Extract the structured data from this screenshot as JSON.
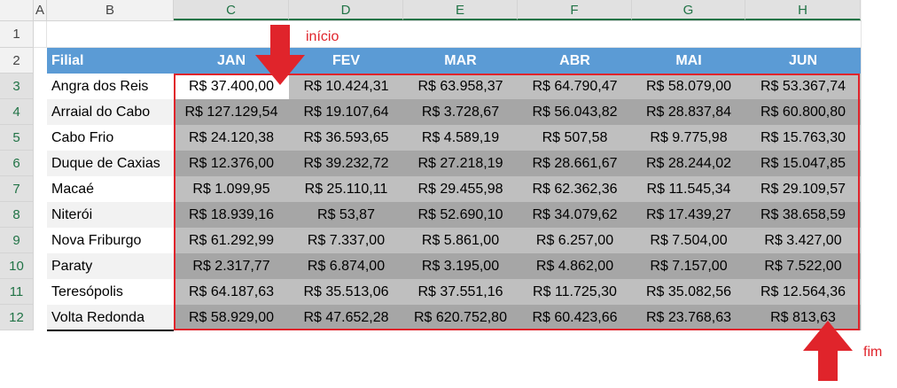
{
  "columns": [
    "A",
    "B",
    "C",
    "D",
    "E",
    "F",
    "G",
    "H"
  ],
  "rows": [
    "1",
    "2",
    "3",
    "4",
    "5",
    "6",
    "7",
    "8",
    "9",
    "10",
    "11",
    "12"
  ],
  "table": {
    "header": [
      "Filial",
      "JAN",
      "FEV",
      "MAR",
      "ABR",
      "MAI",
      "JUN"
    ],
    "rows": [
      {
        "name": "Angra dos Reis",
        "values": [
          "R$ 37.400,00",
          "R$ 10.424,31",
          "R$ 63.958,37",
          "R$ 64.790,47",
          "R$ 58.079,00",
          "R$ 53.367,74"
        ]
      },
      {
        "name": "Arraial do Cabo",
        "values": [
          "R$ 127.129,54",
          "R$ 19.107,64",
          "R$ 3.728,67",
          "R$ 56.043,82",
          "R$ 28.837,84",
          "R$ 60.800,80"
        ]
      },
      {
        "name": "Cabo Frio",
        "values": [
          "R$ 24.120,38",
          "R$ 36.593,65",
          "R$ 4.589,19",
          "R$ 507,58",
          "R$ 9.775,98",
          "R$ 15.763,30"
        ]
      },
      {
        "name": "Duque de Caxias",
        "values": [
          "R$ 12.376,00",
          "R$ 39.232,72",
          "R$ 27.218,19",
          "R$ 28.661,67",
          "R$ 28.244,02",
          "R$ 15.047,85"
        ]
      },
      {
        "name": "Macaé",
        "values": [
          "R$ 1.099,95",
          "R$ 25.110,11",
          "R$ 29.455,98",
          "R$ 62.362,36",
          "R$ 11.545,34",
          "R$ 29.109,57"
        ]
      },
      {
        "name": "Niterói",
        "values": [
          "R$ 18.939,16",
          "R$ 53,87",
          "R$ 52.690,10",
          "R$ 34.079,62",
          "R$ 17.439,27",
          "R$ 38.658,59"
        ]
      },
      {
        "name": "Nova Friburgo",
        "values": [
          "R$ 61.292,99",
          "R$ 7.337,00",
          "R$ 5.861,00",
          "R$ 6.257,00",
          "R$ 7.504,00",
          "R$ 3.427,00"
        ]
      },
      {
        "name": "Paraty",
        "values": [
          "R$ 2.317,77",
          "R$ 6.874,00",
          "R$ 3.195,00",
          "R$ 4.862,00",
          "R$ 7.157,00",
          "R$ 7.522,00"
        ]
      },
      {
        "name": "Teresópolis",
        "values": [
          "R$ 64.187,63",
          "R$ 35.513,06",
          "R$ 37.551,16",
          "R$ 11.725,30",
          "R$ 35.082,56",
          "R$ 12.564,36"
        ]
      },
      {
        "name": "Volta Redonda",
        "values": [
          "R$ 58.929,00",
          "R$ 47.652,28",
          "R$ 620.752,80",
          "R$ 60.423,66",
          "R$ 23.768,63",
          "R$ 813,63"
        ]
      }
    ]
  },
  "annotations": {
    "start_label": "início",
    "end_label": "fim",
    "arrow_start_icon": "arrow-down-icon",
    "arrow_end_icon": "arrow-up-icon"
  },
  "colors": {
    "header_blue": "#5b9bd5",
    "row_gray": "#bfbfbf",
    "row_gray_dark": "#a6a6a6",
    "name_alt": "#f2f2f2",
    "annotation_red": "#e0242b",
    "selected_cell": "#ffffff"
  }
}
